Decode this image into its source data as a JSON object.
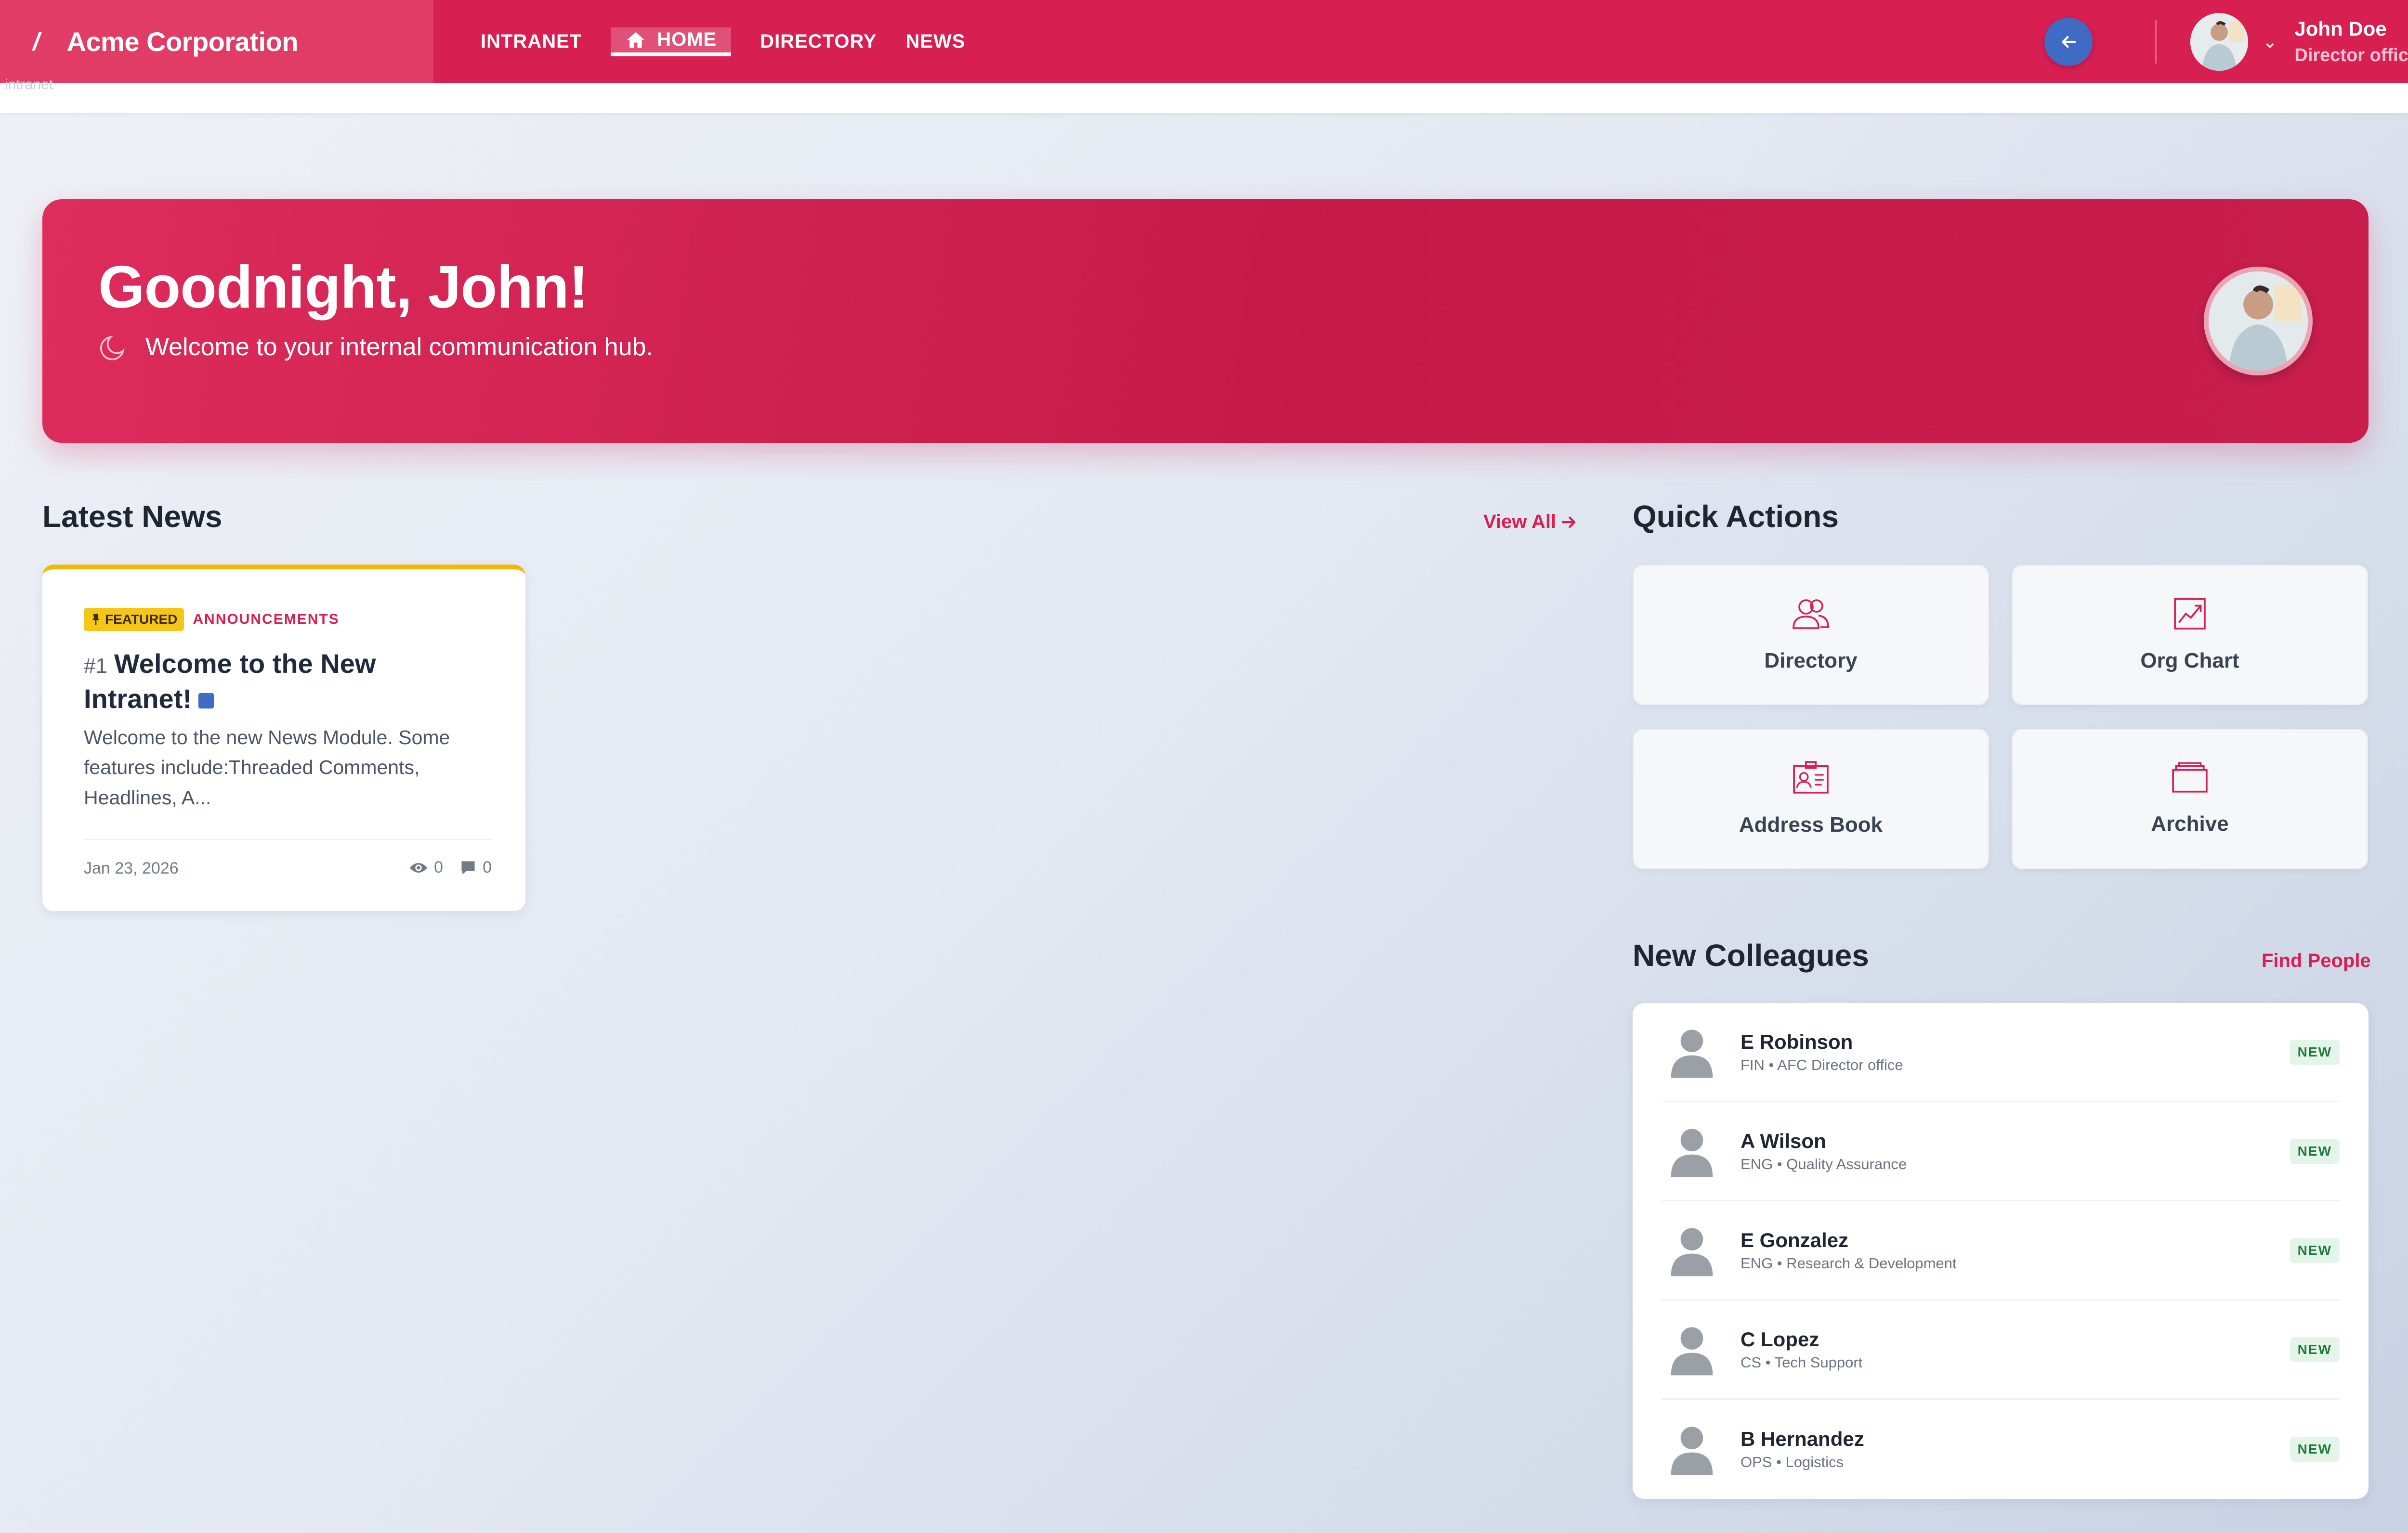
{
  "navbar": {
    "brand_mark": "/",
    "brand_name": "Acme Corporation",
    "links": [
      {
        "label": "INTRANET"
      },
      {
        "label": "HOME"
      },
      {
        "label": "DIRECTORY"
      },
      {
        "label": "NEWS"
      }
    ],
    "user": {
      "name": "John Doe",
      "role": "Director office"
    },
    "colors": {
      "primary": "#d81f52",
      "brand_bg": "#e03c66",
      "back_button": "#3f6bc4"
    }
  },
  "subbar": {
    "crumb": "intranet"
  },
  "hero": {
    "title": "Goodnight, John!",
    "subtitle": "Welcome to your internal communication hub.",
    "icon": "moon-icon"
  },
  "latest_news": {
    "title": "Latest News",
    "view_all": "View All",
    "card": {
      "featured_label": "FEATURED",
      "category": "ANNOUNCEMENTS",
      "number": "#1",
      "title": "Welcome to the New Intranet!",
      "excerpt": "Welcome to the new News Module. Some features include:Threaded Comments, Headlines, A...",
      "date": "Jan 23, 2026",
      "views": "0",
      "comments": "0"
    }
  },
  "quick_actions": {
    "title": "Quick Actions",
    "items": [
      {
        "label": "Directory",
        "icon": "users-icon"
      },
      {
        "label": "Org Chart",
        "icon": "chart-icon"
      },
      {
        "label": "Address Book",
        "icon": "address-book-icon"
      },
      {
        "label": "Archive",
        "icon": "archive-icon"
      }
    ]
  },
  "new_colleagues": {
    "title": "New Colleagues",
    "find_people": "Find People",
    "badge_label": "NEW",
    "people": [
      {
        "name": "E Robinson",
        "meta": "FIN • AFC Director office"
      },
      {
        "name": "A Wilson",
        "meta": "ENG • Quality Assurance"
      },
      {
        "name": "E Gonzalez",
        "meta": "ENG • Research & Development"
      },
      {
        "name": "C Lopez",
        "meta": "CS • Tech Support"
      },
      {
        "name": "B Hernandez",
        "meta": "OPS • Logistics"
      }
    ]
  }
}
